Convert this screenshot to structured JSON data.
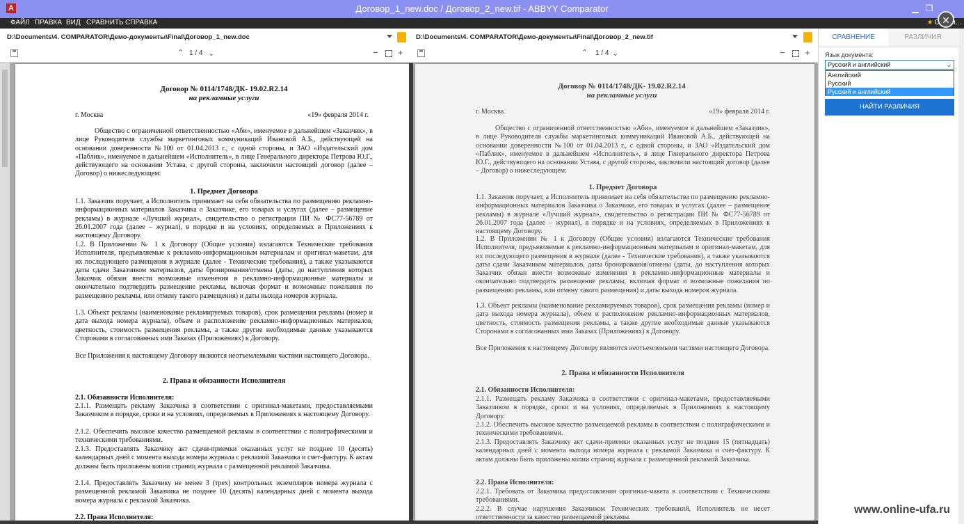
{
  "window": {
    "title": "Договор_1_new.doc / Договор_2_new.tif - ABBYY Comparator",
    "minimize": "▁",
    "maximize": "❐",
    "close": "✕"
  },
  "menu": {
    "items": [
      "ФАЙЛ",
      "ПРАВКА",
      "ВИД",
      "СРАВНИТЬ",
      "СПРАВКА"
    ],
    "rate_label": "Оцени..."
  },
  "overlay_close": "✕",
  "left_pane": {
    "path": "D:\\Documents\\4. COMPARATOR\\Демо-документы\\Final\\Договор_1_new.doc",
    "page_indicator": "1 / 4"
  },
  "right_pane": {
    "path": "D:\\Documents\\4. COMPARATOR\\Демо-документы\\Final\\Договор_2_new.tif",
    "page_indicator": "1 / 4"
  },
  "doc1": {
    "title": "Договор № 0114/1748/ДК- 19.02.R2.14",
    "subtitle": "на рекламные услуги",
    "city": "г. Москва",
    "date": "«19» февраля 2014 г.",
    "intro": "Общество с ограниченной ответственностью «Аби», именуемое в дальнейшем «Заказчик», в лице Руководителя службы маркетинговых коммуникаций Ивановой А.Б., действующей на основании доверенности №100 от 01.04.2013 г., с одной стороны, и ЗАО «Издательский дом «Паблик», именуемое в дальнейшем «Исполнитель», в лице Генерального директора Петрова Ю.Г., действующего на основании Устава, с другой стороны, заключили настоящий договор (далее – Договор) о нижеследующем:",
    "section1": "1.   Предмет Договора",
    "p11": "1.1. Заказчик поручает, а Исполнитель принимает на себя обязательства по размещению рекламно-информационных материалов Заказчика о Заказчике, его товарах и услугах (далее – размещение рекламы) в журнале «Лучший журнал», свидетельство о регистрации ПИ № ФС77-56789 от 26.01.2007 года (далее – журнал), в порядке и на условиях, определяемых в Приложениях к настоящему Договору.",
    "p12": "1.2. В Приложении № 1 к Договору (Общие условия) излагаются Технические требования Исполнителя, предъявляемые к рекламно-информационным материалам и оригинал-макетам, для их последующего размещения в журнале (далее - Технические требования), а также указываются даты сдачи Заказчиком материалов, даты бронирования/отмены (даты, до наступления которых Заказчик обязан внести возможные изменения в рекламно-информационные материалы и окончательно подтвердить размещение рекламы, включая формат и возможные пожелания по размещению рекламы, или отмену такого размещения) и даты выхода номеров журнала.",
    "p13": "1.3. Объект рекламы (наименование рекламируемых товаров), срок размещения рекламы (номер и дата выхода номера журнала), объем и расположение рекламно-информационных материалов, цветность, стоимость размещения рекламы, а также другие необходимые данные указываются Сторонами в согласованных ими Заказах (Приложениях) к Договору.",
    "p14": "Все Приложения к настоящему Договору являются неотъемлемыми частями настоящего Договора.",
    "section2": "2.   Права и обязанности Исполнителя",
    "sub21": "2.1. Обязанности Исполнителя:",
    "p211": "2.1.1. Размещать рекламу Заказчика в соответствии с оригинал-макетами, предоставляемыми Заказчиком в порядке, сроки и на условиях, определяемых в Приложениях к настоящему Договору.",
    "p212": "2.1.2. Обеспечить высокое качество размещаемой рекламы в соответствии с полиграфическими и техническими требованиями.",
    "p213": "2.1.3. Предоставлять Заказчику акт сдачи-приемки оказанных услуг не позднее 10 (десять) календарных дней с момента выхода номера журнала с рекламой Заказчика и счет-фактуру. К актам должны быть приложены копии страниц журнала с размещенной рекламой Заказчика.",
    "p214": "2.1.4. Предоставлять Заказчику не менее 3 (трех) контрольных экземпляров номера журнала с размещенной рекламой Заказчика не позднее 10 (десять) календарных дней с момента выхода номера журнала с рекламой Заказчика.",
    "sub22": "2.2. Права Исполнителя:"
  },
  "doc2": {
    "title": "Договор № 0114/1748/ДК- 19.02.R2.14",
    "subtitle": "на рекламные услуги",
    "city": "г. Москва",
    "date": "«19» февраля 2014 г.",
    "intro": "Общество с ограниченной ответственностью «Аби», именуемое в дальнейшем «Заказчик», в лице Руководителя службы маркетинговых коммуникаций Ивановой А.Б., действующей на основании доверенности №100 от 01.04.2013 г., с одной стороны, и ЗАО «Издательский дом «Паблик», именуемое в дальнейшем «Исполнитель», в лице Генерального директора Петрова Ю.Г., действующего на основании Устава, с другой стороны, заключили настоящий договор (далее – Договор) о нижеследующем:",
    "section1": "1.   Предмет Договора",
    "p11": "1.1. Заказчик поручает, а Исполнитель принимает на себя обязательства по размещению рекламно-информационных материалов Заказчика о Заказчике, его товарах и услугах (далее – размещение рекламы) в журнале «Лучший журнал», свидетельство о регистрации ПИ № ФС77-56789 от 26.01.2007 года (далее – журнал), в порядке и на условиях, определяемых в Приложениях к настоящему Договору.",
    "p12": "1.2. В Приложении № 1 к Договору (Общие условия) излагаются Технические требования Исполнителя, предъявляемые к рекламно-информационным материалам и оригинал-макетам, для их последующего размещения в журнале (далее - Технические требования), а также указываются даты сдачи Заказчиком материалов, даты бронирования/отмены (даты, до наступления которых Заказчик обязан внести возможные изменения в рекламно-информационные материалы и окончательно подтвердить размещение рекламы, включая формат и возможные пожелания по размещению рекламы, или отмену такого размещения) и даты выхода номеров журнала.",
    "p13": "1.3. Объект рекламы (наименование рекламируемых товаров), срок размещения рекламы (номер и дата выхода номера журнала), объем и расположение рекламно-информационных материалов, цветность, стоимость размещения рекламы, а также другие необходимые данные указываются Сторонами в согласованных ими Заказах (Приложениях) к Договору.",
    "p14": "Все Приложения к настоящему Договору являются неотъемлемыми частями настоящего Договора.",
    "section2": "2.   Права и обязанности Исполнителя",
    "sub21": "2.1. Обязанности Исполнителя:",
    "p211": "2.1.1. Размещать рекламу Заказчика в соответствии с оригинал-макетами, предоставляемыми Заказчиком в порядке, сроки и на условиях, определяемых в Приложениях к настоящему Договору.",
    "p212": "2.1.2. Обеспечить высокое качество размещаемой рекламы в соответствии с полиграфическими и техническими требованиями.",
    "p213": "2.1.3. Предоставлять Заказчику акт сдачи-приемки оказанных услуг не позднее 15 (пятнадцать) календарных дней с момента выхода номера журнала с рекламой Заказчика и счет-фактуру. К актам должны быть приложены копии страниц журнала с размещенной рекламой Заказчика.",
    "sub22": "2.2. Права Исполнителя:",
    "p221": "2.2.1. Требовать от Заказчика предоставления оригинал-макета в соответствии с Техническими требованиями.",
    "p222": "2.2.2. В случае нарушения Заказчиком Технических требований, Исполнитель не несет ответственности за качество размещаемой рекламы."
  },
  "sidebar": {
    "tab_compare": "СРАВНЕНИЕ",
    "tab_differences": "РАЗЛИЧИЯ",
    "lang_label": "Язык документа:",
    "lang_selected": "Русский и английский",
    "lang_options": [
      "Английский",
      "Русский",
      "Русский и английский"
    ],
    "find_button": "НАЙТИ РАЗЛИЧИЯ"
  },
  "watermark": "www.online-ufa.ru",
  "icons": {
    "app": "abbyy-app-icon",
    "folder": "folder-icon",
    "save": "save-icon",
    "star": "star-icon"
  }
}
